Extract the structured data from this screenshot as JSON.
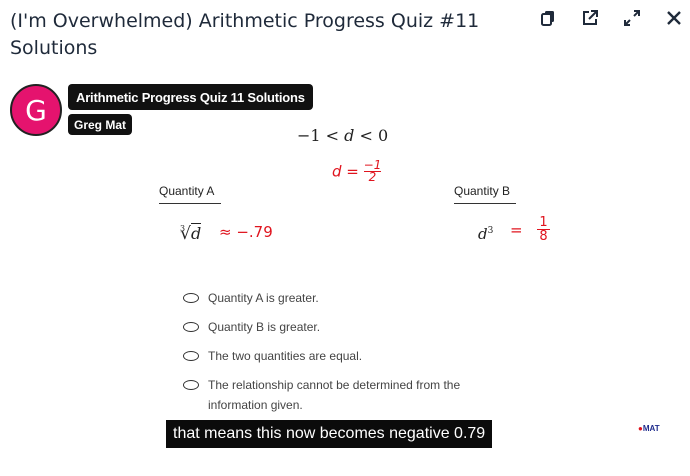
{
  "header": {
    "title": "(I'm Overwhelmed) Arithmetic Progress Quiz #11 Solutions",
    "actions": [
      {
        "name": "copy",
        "icon": "copy-icon"
      },
      {
        "name": "share",
        "icon": "external-link-icon"
      },
      {
        "name": "fullscreen",
        "icon": "expand-icon"
      },
      {
        "name": "close",
        "icon": "close-icon"
      }
    ]
  },
  "video": {
    "avatar_letter": "G",
    "avatar_color": "#e5136e",
    "title_chip": "Arithmetic Progress Quiz 11 Solutions",
    "author_chip": "Greg Mat",
    "caption": "that means this now becomes negative 0.79",
    "watermark": "MAT"
  },
  "problem": {
    "condition": {
      "left": "−1 < ",
      "var": "d",
      "right": " < 0"
    },
    "annotation_d": {
      "lhs": "d =",
      "num": "−1",
      "den": "2"
    },
    "quantity_a": {
      "label": "Quantity A",
      "expression_index": "3",
      "expression_var": "d",
      "annotation": "≈ −.79"
    },
    "quantity_b": {
      "label": "Quantity B",
      "expression_base": "d",
      "expression_exp": "3",
      "annotation_eq": "=",
      "annotation_num": "1",
      "annotation_den": "8"
    },
    "options": [
      "Quantity A is greater.",
      "Quantity B is greater.",
      "The two quantities are equal.",
      "The relationship cannot be determined from the information given."
    ]
  },
  "colors": {
    "annotation": "#e0141e",
    "caption_bg": "#0b0b0b"
  }
}
